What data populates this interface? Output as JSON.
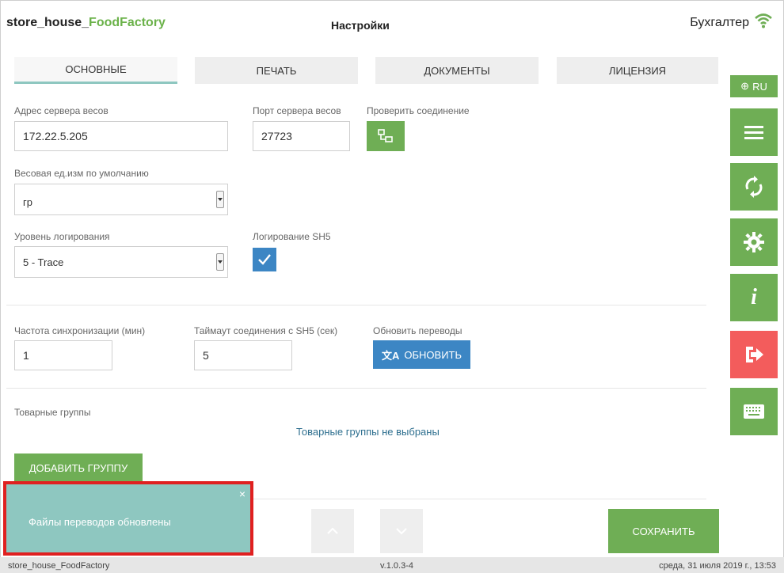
{
  "header": {
    "brand_prefix": "store_house_",
    "brand_suffix": "FoodFactory",
    "title": "Настройки",
    "user": "Бухгалтер"
  },
  "tabs": [
    {
      "label": "ОСНОВНЫЕ"
    },
    {
      "label": "ПЕЧАТЬ"
    },
    {
      "label": "ДОКУМЕНТЫ"
    },
    {
      "label": "ЛИЦЕНЗИЯ"
    }
  ],
  "sidebar": {
    "lang": "RU",
    "buttons": [
      {
        "icon": "menu-icon"
      },
      {
        "icon": "sync-icon"
      },
      {
        "icon": "gear-icon"
      },
      {
        "icon": "info-icon"
      },
      {
        "icon": "logout-icon"
      },
      {
        "icon": "keyboard-icon"
      }
    ]
  },
  "form": {
    "scale_server_address_label": "Адрес сервера весов",
    "scale_server_address_value": "172.22.5.205",
    "scale_server_port_label": "Порт сервера весов",
    "scale_server_port_value": "27723",
    "check_connection_label": "Проверить соединение",
    "default_unit_label": "Весовая ед.изм по умолчанию",
    "default_unit_value": "гр",
    "log_level_label": "Уровень логирования",
    "log_level_value": "5 - Trace",
    "sh5_logging_label": "Логирование SH5",
    "sync_frequency_label": "Частота синхронизации (мин)",
    "sync_frequency_value": "1",
    "sh5_timeout_label": "Таймаут соединения с SH5 (сек)",
    "sh5_timeout_value": "5",
    "update_translations_label": "Обновить переводы",
    "update_button_label": "ОБНОВИТЬ",
    "product_groups_label": "Товарные группы",
    "product_groups_empty": "Товарные группы не выбраны",
    "add_group_button": "ДОБАВИТЬ ГРУППУ"
  },
  "toast": {
    "message": "Файлы переводов обновлены",
    "close": "×"
  },
  "save_button": "СОХРАНИТЬ",
  "footer": {
    "app": "store_house_FoodFactory",
    "version": "v.1.0.3-4",
    "datetime": "среда, 31 июля 2019 г., 13:53"
  },
  "colors": {
    "green": "#6fae55",
    "blue": "#3c86c4",
    "red": "#f35c5c",
    "teal": "#8ec7c0",
    "highlight": "#e02020"
  }
}
